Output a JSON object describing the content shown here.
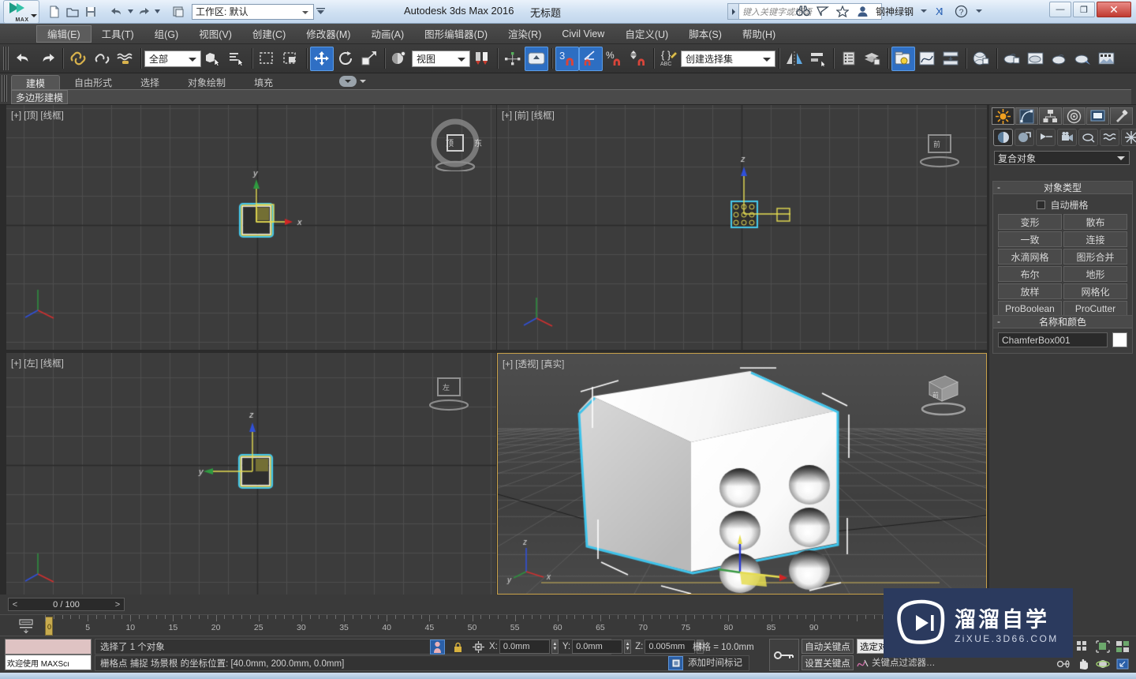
{
  "titlebar": {
    "app_title": "Autodesk 3ds Max 2016",
    "doc_title": "无标题",
    "workspace": "工作区: 默认",
    "search_placeholder": "键入关键字或短语",
    "user_name": "钢神绿钢",
    "minimize": "—",
    "maximize": "❐",
    "close": "✕",
    "quick_icons": [
      "new-icon",
      "open-icon",
      "save-icon",
      "undo-icon",
      "redo-icon",
      "set-project-icon"
    ],
    "right_icons": [
      "binoculars-icon",
      "share-icon",
      "star-icon",
      "user-icon",
      "exchange-icon",
      "help-icon"
    ]
  },
  "menu": {
    "items": [
      {
        "label": "编辑(E)",
        "active": true
      },
      {
        "label": "工具(T)",
        "active": false
      },
      {
        "label": "组(G)",
        "active": false
      },
      {
        "label": "视图(V)",
        "active": false
      },
      {
        "label": "创建(C)",
        "active": false
      },
      {
        "label": "修改器(M)",
        "active": false
      },
      {
        "label": "动画(A)",
        "active": false
      },
      {
        "label": "图形编辑器(D)",
        "active": false
      },
      {
        "label": "渲染(R)",
        "active": false
      },
      {
        "label": "Civil View",
        "active": false
      },
      {
        "label": "自定义(U)",
        "active": false
      },
      {
        "label": "脚本(S)",
        "active": false
      },
      {
        "label": "帮助(H)",
        "active": false
      }
    ]
  },
  "toolbar": {
    "selection_filter": "全部",
    "ref_coord_system": "视图",
    "named_selection_set": "创建选择集",
    "snap_percent_label": "%",
    "snap3_label": "3"
  },
  "ribbon": {
    "tabs": [
      {
        "label": "建模",
        "selected": true
      },
      {
        "label": "自由形式",
        "selected": false
      },
      {
        "label": "选择",
        "selected": false
      },
      {
        "label": "对象绘制",
        "selected": false
      },
      {
        "label": "填充",
        "selected": false
      }
    ],
    "panel_label": "多边形建模"
  },
  "viewports": [
    {
      "name": "top",
      "label": "[+] [顶] [线框]",
      "selected": false
    },
    {
      "name": "front",
      "label": "[+] [前] [线框]",
      "selected": false
    },
    {
      "name": "left",
      "label": "[+] [左] [线框]",
      "selected": false
    },
    {
      "name": "perspective",
      "label": "[+] [透视] [真实]",
      "selected": true
    }
  ],
  "viewcube_labels": {
    "top": "顶",
    "front": "前",
    "left": "左",
    "persp": "前"
  },
  "axis_labels": {
    "x": "x",
    "y": "y",
    "z": "z"
  },
  "timeline": {
    "frame_display": "0 / 100",
    "prev_arrow": "<",
    "next_arrow": ">",
    "current_frame": "0",
    "ticks": [
      0,
      5,
      10,
      15,
      20,
      25,
      30,
      35,
      40,
      45,
      50,
      55,
      60,
      65,
      70,
      75,
      80,
      85,
      90
    ],
    "range_start": 0,
    "range_end": 100
  },
  "status": {
    "maxscript_listener_label": "欢迎使用 MAXScı",
    "selection_text": "选择了 1 个对象",
    "prompt_text": "栅格点 捕捉 场景根 的坐标位置:  [40.0mm, 200.0mm, 0.0mm]",
    "coords": [
      {
        "axis": "X:",
        "value": "0.0mm"
      },
      {
        "axis": "Y:",
        "value": "0.0mm"
      },
      {
        "axis": "Z:",
        "value": "0.005mm"
      }
    ],
    "grid_label": "栅格 = 10.0mm",
    "add_time_tag": "添加时间标记",
    "auto_key": "自动关键点",
    "set_key": "设置关键点",
    "selected_objects": "选定对象",
    "key_filters": "关键点过滤器…"
  },
  "command_panel": {
    "tabs": [
      "create-tab",
      "modify-tab",
      "hierarchy-tab",
      "motion-tab",
      "display-tab",
      "utilities-tab"
    ],
    "category_buttons": [
      "geometry-icon",
      "shapes-icon",
      "lights-icon",
      "cameras-icon",
      "helpers-icon",
      "space-warps-icon",
      "systems-icon"
    ],
    "dropdown_value": "复合对象",
    "rollouts": [
      {
        "title": "对象类型",
        "minus": "-",
        "checkbox_label": "自动栅格",
        "buttons": [
          [
            "变形",
            "散布"
          ],
          [
            "一致",
            "连接"
          ],
          [
            "水滴网格",
            "图形合并"
          ],
          [
            "布尔",
            "地形"
          ],
          [
            "放样",
            "网格化"
          ],
          [
            "ProBoolean",
            "ProCutter"
          ]
        ]
      },
      {
        "title": "名称和颜色",
        "minus": "-",
        "object_name": "ChamferBox001",
        "color": "#ffffff"
      }
    ]
  },
  "watermark": {
    "title": "溜溜自学",
    "url": "ZiXUE.3D66.COM"
  },
  "colors": {
    "accent_blue": "#2f6fc4",
    "selection_cyan": "#3ec1e8",
    "gizmo_yellow": "#e8e04a",
    "axis_red": "#e03030",
    "axis_green": "#2faa40",
    "axis_blue": "#3050e0",
    "viewport_bg": "#3c3c3c",
    "panel_bg": "#3a3a3a",
    "watermark_bg": "#2b3a5e"
  }
}
